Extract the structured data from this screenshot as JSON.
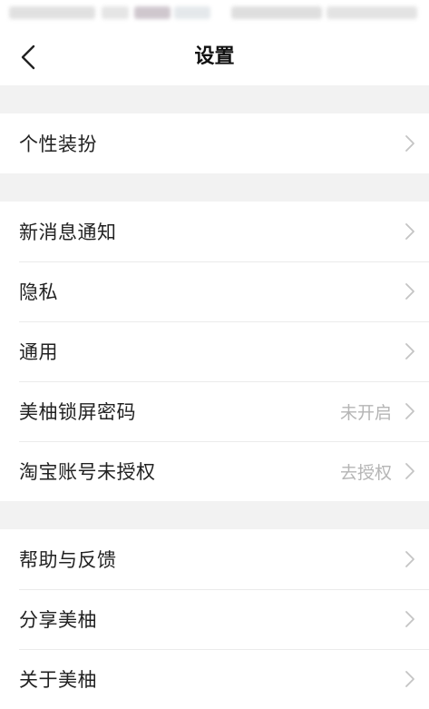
{
  "nav": {
    "title": "设置",
    "back_icon": "chevron-left-icon"
  },
  "groups": [
    {
      "items": [
        {
          "label": "个性装扮",
          "value": ""
        }
      ]
    },
    {
      "items": [
        {
          "label": "新消息通知",
          "value": ""
        },
        {
          "label": "隐私",
          "value": ""
        },
        {
          "label": "通用",
          "value": ""
        },
        {
          "label": "美柚锁屏密码",
          "value": "未开启"
        },
        {
          "label": "淘宝账号未授权",
          "value": "去授权"
        }
      ]
    },
    {
      "items": [
        {
          "label": "帮助与反馈",
          "value": ""
        },
        {
          "label": "分享美柚",
          "value": ""
        },
        {
          "label": "关于美柚",
          "value": ""
        }
      ]
    }
  ],
  "colors": {
    "section_gap": "#f2f2f2",
    "divider": "#ebebeb",
    "value_text": "#b5b5b5",
    "chevron": "#c4c4c4"
  }
}
